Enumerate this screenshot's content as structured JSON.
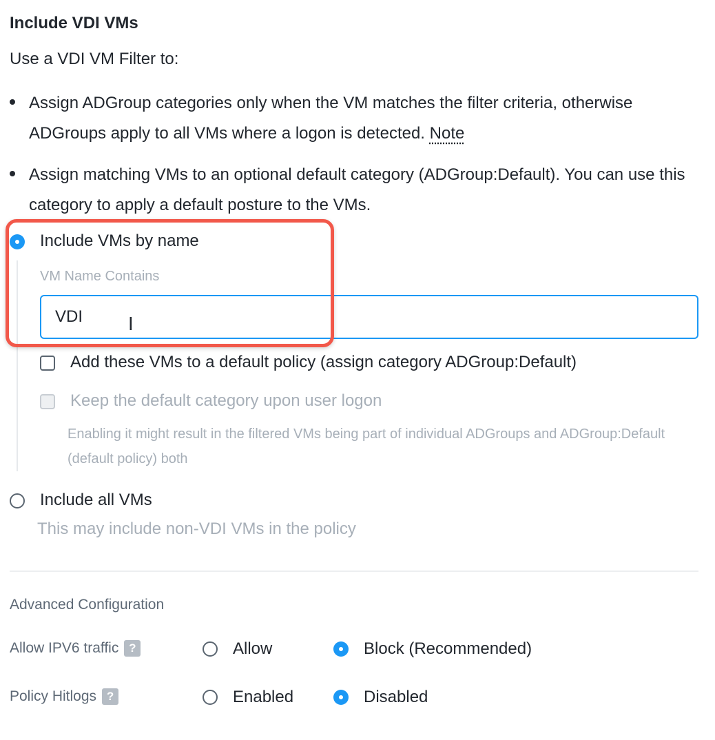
{
  "section": {
    "title": "Include VDI VMs",
    "intro": "Use a VDI VM Filter to:",
    "bullets": [
      {
        "text": "Assign ADGroup categories only when the VM matches the filter criteria, otherwise ADGroups apply to all VMs where a logon is detected.",
        "link": "Note"
      },
      {
        "text": "Assign matching VMs to an optional default category (ADGroup:Default). You can use this category to apply a default posture to the VMs."
      }
    ]
  },
  "filter": {
    "by_name": {
      "label": "Include VMs by name",
      "selected": true,
      "field_label": "VM Name Contains",
      "field_value": "VDI",
      "cursor_glyph": "I"
    },
    "default_policy": {
      "label": "Add these VMs to a default policy (assign category ADGroup:Default)",
      "checked": false
    },
    "keep_default": {
      "label": "Keep the default category upon user logon",
      "checked": false,
      "disabled": true,
      "help": "Enabling it might result in the filtered VMs being part of individual ADGroups and ADGroup:Default (default policy) both"
    },
    "all_vms": {
      "label": "Include all VMs",
      "selected": false,
      "help": "This may include non-VDI VMs in the policy"
    }
  },
  "advanced": {
    "title": "Advanced Configuration",
    "ipv6": {
      "label": "Allow IPV6 traffic",
      "help_icon": "question-icon",
      "options": [
        "Allow",
        "Block (Recommended)"
      ],
      "selected": "Block (Recommended)"
    },
    "hitlogs": {
      "label": "Policy Hitlogs",
      "help_icon": "question-icon",
      "options": [
        "Enabled",
        "Disabled"
      ],
      "selected": "Disabled"
    }
  },
  "colors": {
    "accent": "#1b98f5",
    "highlight": "#f2584a",
    "muted_text": "#a7afb8"
  }
}
